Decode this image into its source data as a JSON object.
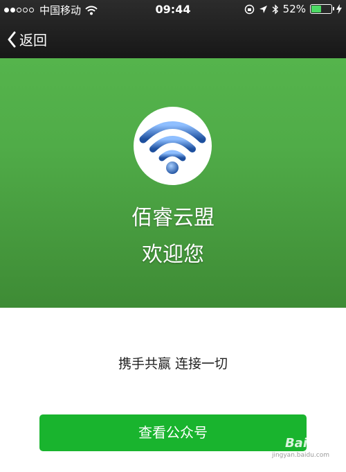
{
  "status_bar": {
    "carrier": "中国移动",
    "time": "09:44",
    "battery_percent": "52%",
    "battery_level": 0.52,
    "icons": [
      "signal-dots-icon",
      "wifi-icon",
      "rotation-lock-icon",
      "location-arrow-icon",
      "bluetooth-icon",
      "battery-icon",
      "charging-bolt-icon"
    ]
  },
  "nav": {
    "back_label": "返回",
    "back_icon": "chevron-left-icon"
  },
  "banner": {
    "logo_icon": "wifi-logo-icon",
    "title_line1": "佰睿云盟",
    "title_line2": "欢迎您",
    "colors": {
      "banner_top": "#55b44c",
      "banner_bottom": "#3e8b35"
    }
  },
  "main": {
    "slogan": "携手共赢 连接一切"
  },
  "action": {
    "button_label": "查看公众号",
    "button_color": "#19b42e"
  },
  "watermark": {
    "brand": "Bai经验",
    "url": "jingyan.baidu.com"
  }
}
